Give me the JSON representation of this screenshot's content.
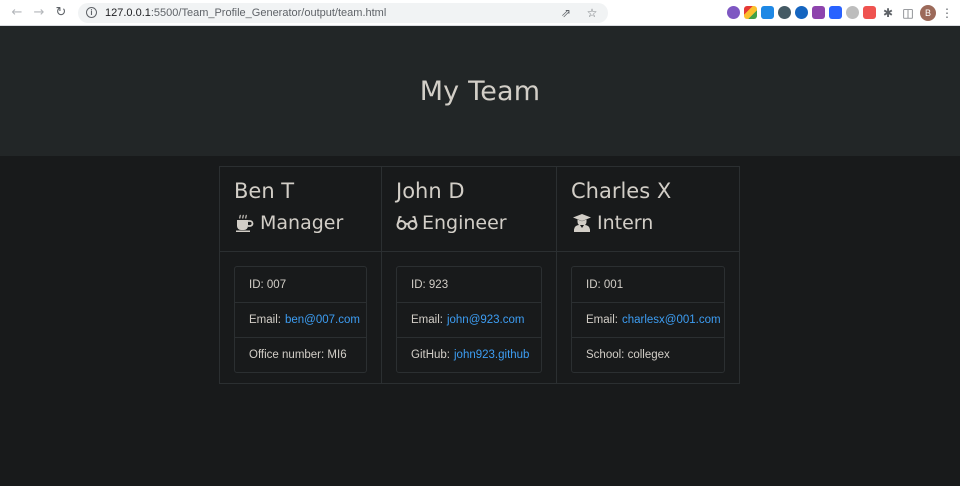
{
  "browser": {
    "url_host": "127.0.0.1",
    "url_path": ":5500/Team_Profile_Generator/output/team.html",
    "profile_initial": "B"
  },
  "page": {
    "title": "My Team"
  },
  "team": [
    {
      "name": "Ben T",
      "role": "Manager",
      "icon": "coffee-icon",
      "id_label": "ID:",
      "id": "007",
      "email_label": "Email:",
      "email": "ben@007.com",
      "extra_label": "Office number:",
      "extra_value": "MI6",
      "extra_is_link": false
    },
    {
      "name": "John D",
      "role": "Engineer",
      "icon": "glasses-icon",
      "id_label": "ID:",
      "id": "923",
      "email_label": "Email:",
      "email": "john@923.com",
      "extra_label": "GitHub:",
      "extra_value": "john923.github",
      "extra_is_link": true
    },
    {
      "name": "Charles X",
      "role": "Intern",
      "icon": "graduate-icon",
      "id_label": "ID:",
      "id": "001",
      "email_label": "Email:",
      "email": "charlesx@001.com",
      "extra_label": "School:",
      "extra_value": "collegex",
      "extra_is_link": false
    }
  ],
  "colors": {
    "link": "#3d9df2",
    "text": "#d2cec7",
    "background": "#181a1b",
    "jumbotron": "#222627"
  }
}
